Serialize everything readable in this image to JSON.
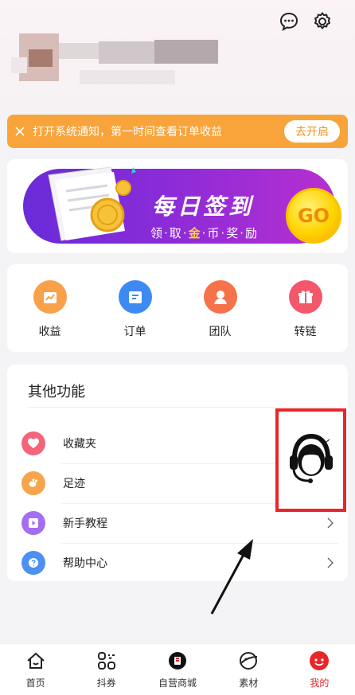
{
  "notify": {
    "text": "打开系统通知，第一时间查看订单收益",
    "button": "去开启"
  },
  "banner": {
    "title": "每日签到",
    "sub_parts": [
      "领",
      "取",
      "金",
      "币",
      "奖",
      "励"
    ],
    "go": "GO"
  },
  "quick": [
    {
      "label": "收益",
      "icon": "earnings-icon",
      "color": "#f9a04a"
    },
    {
      "label": "订单",
      "icon": "order-icon",
      "color": "#3d8bf2"
    },
    {
      "label": "团队",
      "icon": "team-icon",
      "color": "#f5734a"
    },
    {
      "label": "转链",
      "icon": "gift-icon",
      "color": "#f2576a"
    }
  ],
  "other": {
    "title": "其他功能",
    "items": [
      {
        "label": "收藏夹",
        "icon": "heart-icon",
        "color": "#f2657a"
      },
      {
        "label": "足迹",
        "icon": "footprint-icon",
        "color": "#f6a54a"
      },
      {
        "label": "新手教程",
        "icon": "play-icon",
        "color": "#a36ef0"
      },
      {
        "label": "帮助中心",
        "icon": "help-icon",
        "color": "#4d8ff3"
      }
    ]
  },
  "nav": [
    {
      "label": "首页",
      "icon": "home-icon"
    },
    {
      "label": "抖券",
      "icon": "coupon-icon"
    },
    {
      "label": "自营商城",
      "icon": "mall-icon"
    },
    {
      "label": "素材",
      "icon": "material-icon"
    },
    {
      "label": "我的",
      "icon": "mine-icon",
      "active": true
    }
  ]
}
